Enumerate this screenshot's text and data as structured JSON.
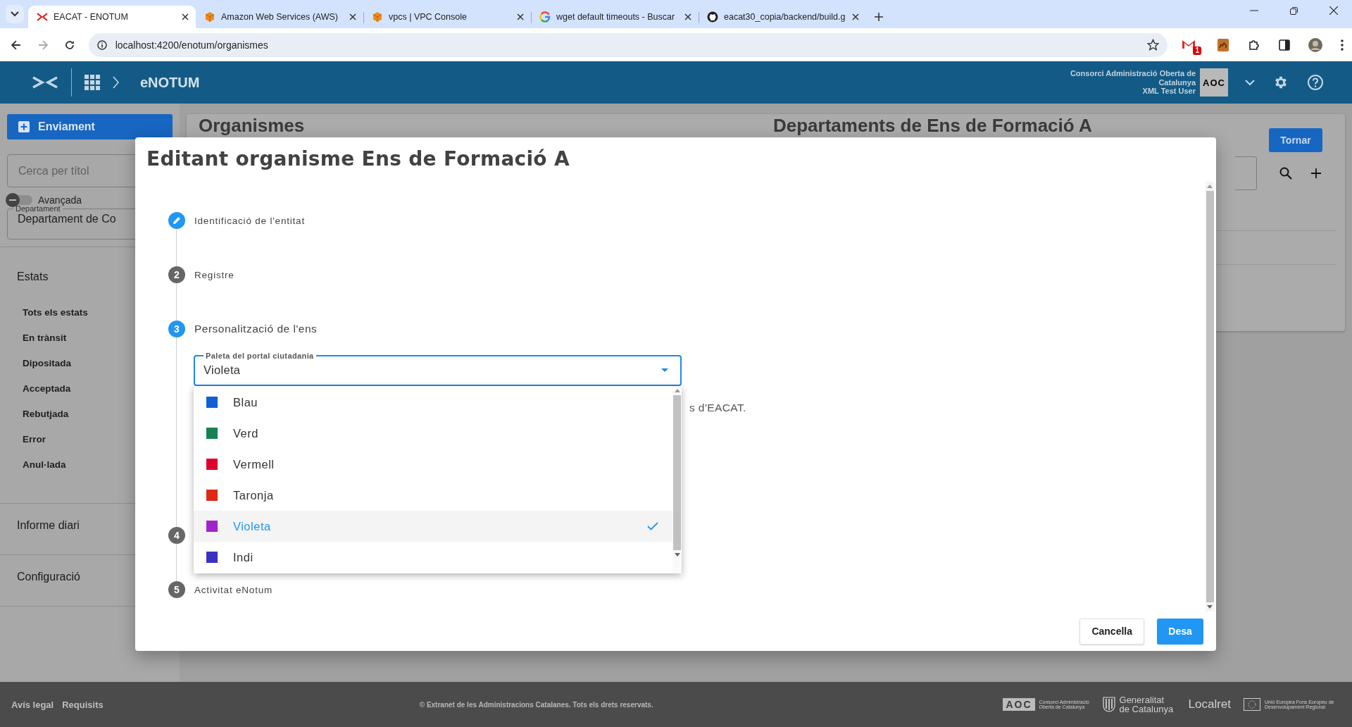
{
  "browser": {
    "tabs": [
      {
        "title": "EACAT - ENOTUM",
        "kind": "eacat",
        "selected": true
      },
      {
        "title": "Amazon Web Services (AWS)",
        "kind": "cube",
        "selected": false
      },
      {
        "title": "vpcs | VPC Console",
        "kind": "cube",
        "selected": false
      },
      {
        "title": "wget default timeouts - Buscar",
        "kind": "google",
        "selected": false
      },
      {
        "title": "eacat30_copia/backend/build.g",
        "kind": "github",
        "selected": false
      }
    ],
    "url": "localhost:4200/enotum/organismes",
    "mail_badge": "1"
  },
  "header": {
    "brand": "eNOTUM",
    "organization_lines": [
      "Consorci Administració Oberta de",
      "Catalunya",
      "XML Test User"
    ],
    "logo": "AOC"
  },
  "sidebar": {
    "new_button": "Enviament",
    "search": {
      "placeholder": "Cerca per títol"
    },
    "advanced": {
      "label": "Avançada",
      "on": false
    },
    "department": {
      "label": "Departament",
      "value": "Departament de Co"
    },
    "sections": [
      {
        "title": "Estats",
        "items": [
          "Tots els estats",
          "En trànsit",
          "Dipositada",
          "Acceptada",
          "Rebutjada",
          "Error",
          "Anul·lada"
        ]
      },
      {
        "title": "Informe diari"
      },
      {
        "title": "Configuració"
      }
    ]
  },
  "main": {
    "title": "Organismes",
    "detail_title": "Departaments de Ens de Formació A",
    "back_button": "Tornar"
  },
  "dialog": {
    "title": "Editant organisme Ens de Formació A",
    "steps": [
      {
        "kind": "edit",
        "label": "Identificació de l'entitat"
      },
      {
        "kind": "inactive",
        "number": "2",
        "label": "Registre"
      },
      {
        "kind": "active",
        "number": "3",
        "label": "Personalització de l'ens"
      },
      {
        "kind": "inactive",
        "number": "4"
      },
      {
        "kind": "inactive",
        "number": "5",
        "label": "Activitat eNotum"
      }
    ],
    "palette_field": {
      "label": "Paleta del portal ciutadania",
      "value": "Violeta"
    },
    "options": [
      {
        "label": "Blau",
        "color": "#1160d4",
        "selected": false
      },
      {
        "label": "Verd",
        "color": "#168152",
        "selected": false
      },
      {
        "label": "Vermell",
        "color": "#e0002d",
        "selected": false
      },
      {
        "label": "Taronja",
        "color": "#dc2a17",
        "selected": false
      },
      {
        "label": "Violeta",
        "color": "#a322cc",
        "selected": true
      },
      {
        "label": "Indi",
        "color": "#3a33c2",
        "selected": false
      }
    ],
    "hint_fragment": "s d'EACAT.",
    "buttons": [
      {
        "label": "Cancella",
        "kind": "secondary"
      },
      {
        "label": "Desa",
        "kind": "primary"
      }
    ]
  },
  "footer": {
    "links": [
      "Avís legal",
      "Requisits"
    ],
    "copyright": "© Extranet de les Administracions Catalanes. Tots els drets reservats.",
    "partners": [
      {
        "kind": "aoc",
        "mark": "AOC",
        "caption": "Consorci Administració Oberta de Catalunya"
      },
      {
        "kind": "generalitat",
        "caption": "Generalitat de Catalunya"
      },
      {
        "kind": "plain",
        "caption": "Localret"
      },
      {
        "kind": "eu",
        "caption": "Unió Europea Fons Europeu de Desenvolupament Regional"
      }
    ]
  }
}
